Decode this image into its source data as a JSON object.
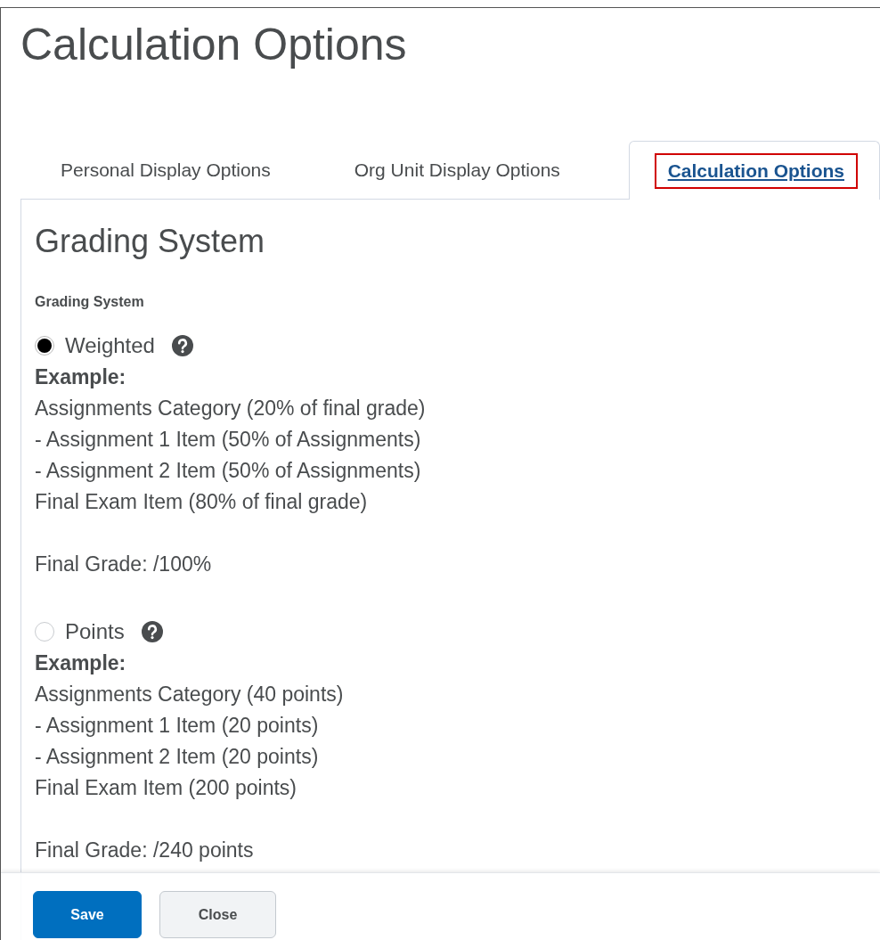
{
  "page_title": "Calculation Options",
  "tabs": [
    {
      "label": "Personal Display Options",
      "selected": false
    },
    {
      "label": "Org Unit Display Options",
      "selected": false
    },
    {
      "label": "Calculation Options",
      "selected": true
    }
  ],
  "section": {
    "heading": "Grading System",
    "field_label": "Grading System",
    "options": [
      {
        "label": "Weighted",
        "selected": true,
        "example_label": "Example:",
        "example_lines": [
          "Assignments Category (20% of final grade)",
          "- Assignment 1 Item (50% of Assignments)",
          "- Assignment 2 Item (50% of Assignments)",
          "Final Exam Item (80% of final grade)"
        ],
        "final_grade": "Final Grade: /100%"
      },
      {
        "label": "Points",
        "selected": false,
        "example_label": "Example:",
        "example_lines": [
          "Assignments Category (40 points)",
          "- Assignment 1 Item (20 points)",
          "- Assignment 2 Item (20 points)",
          "Final Exam Item (200 points)"
        ],
        "final_grade": "Final Grade: /240 points"
      }
    ]
  },
  "buttons": [
    {
      "label": "Save",
      "kind": "primary"
    },
    {
      "label": "Close",
      "kind": "secondary"
    }
  ]
}
